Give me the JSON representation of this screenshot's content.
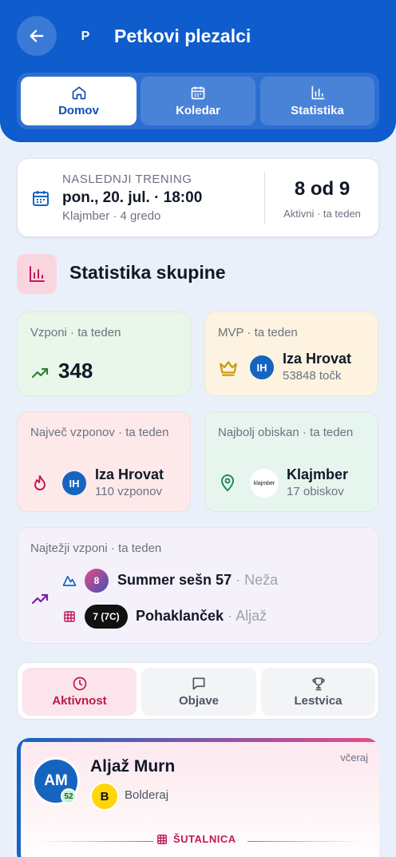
{
  "header": {
    "group_initial": "P",
    "title": "Petkovi plezalci",
    "tabs": [
      {
        "label": "Domov",
        "icon": "home-icon",
        "active": true
      },
      {
        "label": "Koledar",
        "icon": "calendar-icon",
        "active": false
      },
      {
        "label": "Statistika",
        "icon": "bar-chart-icon",
        "active": false
      }
    ]
  },
  "next_training": {
    "label": "NASLEDNJI TRENING",
    "datetime": "pon., 20. jul. · 18:00",
    "place": "Klajmber · 4 gredo",
    "count": "8 od 9",
    "count_label": "Aktivni · ta teden"
  },
  "stats": {
    "title": "Statistika skupine",
    "climbs": {
      "label": "Vzponi · ta teden",
      "value": "348"
    },
    "mvp": {
      "label": "MVP · ta teden",
      "initials": "IH",
      "name": "Iza Hrovat",
      "sub": "53848 točk"
    },
    "most_climbs": {
      "label": "Največ vzponov · ta teden",
      "initials": "IH",
      "name": "Iza Hrovat",
      "sub": "110 vzponov"
    },
    "most_visited": {
      "label": "Najbolj obiskan · ta teden",
      "logo_text": "klajmber",
      "name": "Klajmber",
      "sub": "17 obiskov"
    },
    "hardest": {
      "label": "Najtežji vzponi · ta teden",
      "items": [
        {
          "grade": "8",
          "name": "Summer sešn 57",
          "sep": " · ",
          "who": "Neža"
        },
        {
          "grade": "7 (7C)",
          "name": "Pohaklanček",
          "sep": " · ",
          "who": "Aljaž"
        }
      ]
    }
  },
  "feed_tabs": [
    {
      "label": "Aktivnost",
      "icon": "clock-icon",
      "active": true
    },
    {
      "label": "Objave",
      "icon": "chat-icon",
      "active": false
    },
    {
      "label": "Lestvica",
      "icon": "trophy-icon",
      "active": false
    }
  ],
  "activity": {
    "initials": "AM",
    "level": "52",
    "name": "Aljaž Murn",
    "when": "včeraj",
    "gym_logo": "B",
    "gym": "Bolderaj",
    "tag": "ŠUTALNICA"
  },
  "colors": {
    "brand": "#0f5ccc",
    "accent_pink": "#c2185b",
    "green": "#2e7d32",
    "gold": "#c99a06"
  }
}
